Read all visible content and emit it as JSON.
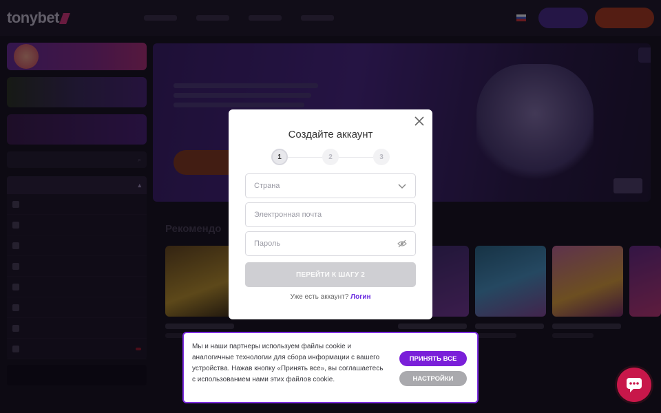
{
  "modal": {
    "title": "Создайте аккаунт",
    "steps": [
      "1",
      "2",
      "3"
    ],
    "country_placeholder": "Страна",
    "email_placeholder": "Электронная почта",
    "password_placeholder": "Пароль",
    "next_button": "ПЕРЕЙТИ К ШАГУ 2",
    "have_account": "Уже есть аккаунт?",
    "login_link": "Логин"
  },
  "cookie": {
    "text": "Мы и наши партнеры используем файлы cookie и аналогичные технологии для сбора информации с вашего устройства. Нажав кнопку «Принять все», вы соглашаетесь с использованием нами этих файлов cookie.",
    "accept_button": "ПРИНЯТЬ ВСЕ",
    "settings_button": "НАСТРОЙКИ"
  },
  "icons": {
    "close": "close-icon",
    "chevron": "chevron-down-icon",
    "eye": "eye-off-icon",
    "chat": "chat-icon"
  },
  "colors": {
    "accent": "#7a1fd9",
    "link": "#6a2ce0",
    "chat": "#c8174a"
  }
}
